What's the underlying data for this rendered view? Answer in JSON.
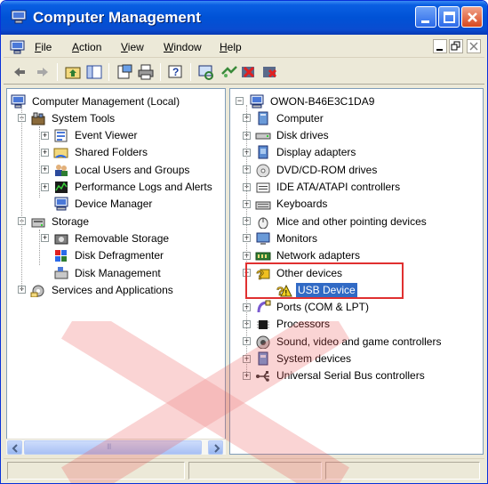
{
  "window": {
    "title": "Computer Management",
    "title_icon": "computer-management-icon"
  },
  "menubar": {
    "items": [
      {
        "label": "File",
        "accel": "F",
        "rest": "ile"
      },
      {
        "label": "Action",
        "accel": "A",
        "rest": "ction"
      },
      {
        "label": "View",
        "accel": "V",
        "rest": "iew"
      },
      {
        "label": "Window",
        "accel": "W",
        "rest": "indow"
      },
      {
        "label": "Help",
        "accel": "H",
        "rest": "elp"
      }
    ]
  },
  "toolbar": {
    "buttons": [
      "back-arrow-icon",
      "forward-arrow-icon",
      "up-folder-icon",
      "show-hide-tree-icon",
      "properties-icon",
      "print-icon",
      "help-icon",
      "scan-hardware-icon",
      "update-driver-icon",
      "uninstall-icon",
      "disable-icon"
    ]
  },
  "left_tree": {
    "root": "Computer Management (Local)",
    "items": [
      {
        "label": "System Tools",
        "level": 1,
        "expander": "−",
        "icon": "toolbox-icon"
      },
      {
        "label": "Event Viewer",
        "level": 2,
        "expander": "+",
        "icon": "event-viewer-icon"
      },
      {
        "label": "Shared Folders",
        "level": 2,
        "expander": "+",
        "icon": "shared-folder-icon"
      },
      {
        "label": "Local Users and Groups",
        "level": 2,
        "expander": "+",
        "icon": "users-icon"
      },
      {
        "label": "Performance Logs and Alerts",
        "level": 2,
        "expander": "+",
        "icon": "performance-icon"
      },
      {
        "label": "Device Manager",
        "level": 2,
        "expander": "",
        "icon": "device-manager-icon",
        "selected": false
      },
      {
        "label": "Storage",
        "level": 1,
        "expander": "−",
        "icon": "storage-icon"
      },
      {
        "label": "Removable Storage",
        "level": 2,
        "expander": "+",
        "icon": "removable-storage-icon"
      },
      {
        "label": "Disk Defragmenter",
        "level": 2,
        "expander": "",
        "icon": "defragmenter-icon"
      },
      {
        "label": "Disk Management",
        "level": 2,
        "expander": "",
        "icon": "disk-management-icon"
      },
      {
        "label": "Services and Applications",
        "level": 1,
        "expander": "+",
        "icon": "services-icon"
      }
    ]
  },
  "right_tree": {
    "root": "OWON-B46E3C1DA9",
    "items": [
      {
        "label": "Computer",
        "expander": "+",
        "icon": "computer-icon"
      },
      {
        "label": "Disk drives",
        "expander": "+",
        "icon": "disk-drive-icon"
      },
      {
        "label": "Display adapters",
        "expander": "+",
        "icon": "display-adapter-icon"
      },
      {
        "label": "DVD/CD-ROM drives",
        "expander": "+",
        "icon": "cdrom-icon"
      },
      {
        "label": "IDE ATA/ATAPI controllers",
        "expander": "+",
        "icon": "ide-controller-icon"
      },
      {
        "label": "Keyboards",
        "expander": "+",
        "icon": "keyboard-icon"
      },
      {
        "label": "Mice and other pointing devices",
        "expander": "+",
        "icon": "mouse-icon"
      },
      {
        "label": "Monitors",
        "expander": "+",
        "icon": "monitor-icon"
      },
      {
        "label": "Network adapters",
        "expander": "+",
        "icon": "network-adapter-icon"
      },
      {
        "label": "Other devices",
        "expander": "−",
        "icon": "unknown-device-icon"
      },
      {
        "label": "USB Device",
        "expander": "",
        "icon": "unknown-device-warning-icon",
        "child": true,
        "selected": true
      },
      {
        "label": "Ports (COM & LPT)",
        "expander": "+",
        "icon": "port-icon"
      },
      {
        "label": "Processors",
        "expander": "+",
        "icon": "processor-icon"
      },
      {
        "label": "Sound, video and game controllers",
        "expander": "+",
        "icon": "sound-icon"
      },
      {
        "label": "System devices",
        "expander": "+",
        "icon": "system-device-icon"
      },
      {
        "label": "Universal Serial Bus controllers",
        "expander": "+",
        "icon": "usb-icon"
      }
    ]
  },
  "scrollbar": {
    "thumb_glyph": "III"
  },
  "colors": {
    "selection": "#316ac5",
    "highlight_box": "#e03030",
    "titlebar": "#0052d6"
  }
}
